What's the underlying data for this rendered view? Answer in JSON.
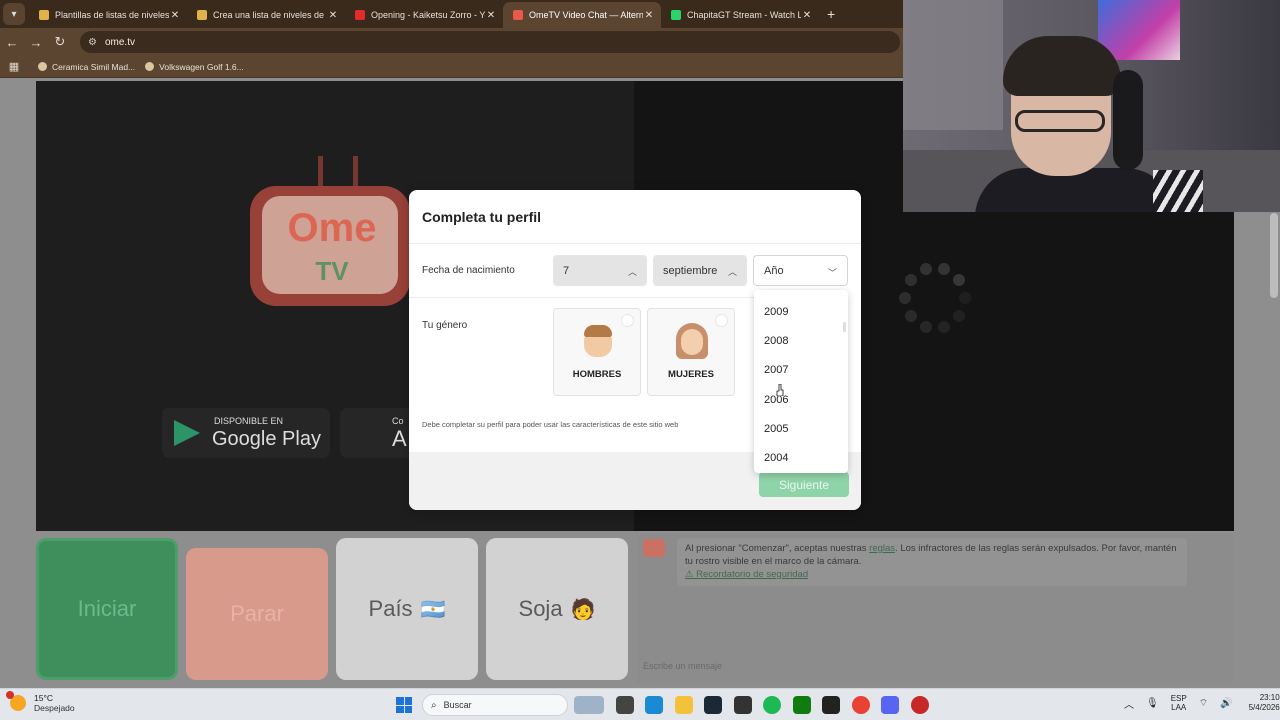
{
  "browser": {
    "tabs": [
      {
        "title": "Plantillas de listas de niveles de",
        "color": "#e0b34a",
        "active": false
      },
      {
        "title": "Crea una lista de niveles de la C",
        "color": "#e0b34a",
        "active": false
      },
      {
        "title": "Opening - Kaiketsu Zorro - You",
        "color": "#e32b2b",
        "active": false
      },
      {
        "title": "OmeTV Video Chat — Alternat",
        "color": "#e9584a",
        "active": true
      },
      {
        "title": "ChapitaGT Stream - Watch Live",
        "color": "#2bd36c",
        "active": false
      }
    ],
    "new_tab": "+",
    "url": "ome.tv",
    "bookmarks": [
      "Ceramica Simil Mad...",
      "Volkswagen Golf 1.6..."
    ]
  },
  "page": {
    "store": {
      "google_small": "DISPONIBLE EN",
      "google_big": "Google Play",
      "apple_small": "Co",
      "apple_big": "A"
    },
    "buttons": {
      "start": "Iniciar",
      "stop": "Parar",
      "country": "País",
      "country_emoji": "🇦🇷",
      "gender": "Soja",
      "gender_emoji": "🧑"
    },
    "chat": {
      "msg_part1": "Al presionar \"Comenzar\", aceptas nuestras ",
      "msg_link": "reglas",
      "msg_part2": ". Los infractores de las reglas serán expulsados. Por favor, mantén tu rostro visible en el marco de la cámara.",
      "security_link": "⚠ Recordatorio de seguridad",
      "input_placeholder": "Escribe un mensaje"
    }
  },
  "modal": {
    "title": "Completa tu perfil",
    "birth_label": "Fecha de nacimiento",
    "day": "7",
    "month": "septiembre",
    "year_placeholder": "Año",
    "gender_label": "Tu género",
    "men": "HOMBRES",
    "women": "MUJERES",
    "note": "Debe completar su perfil para poder usar las características de este sitio web",
    "next": "Siguiente",
    "years": [
      "2009",
      "2008",
      "2007",
      "2006",
      "2005",
      "2004"
    ]
  },
  "taskbar": {
    "temp": "15°C",
    "weather": "Despejado",
    "search": "Buscar",
    "lang1": "ESP",
    "lang2": "LAA",
    "time": "23:10",
    "date": "5/4/2026"
  }
}
